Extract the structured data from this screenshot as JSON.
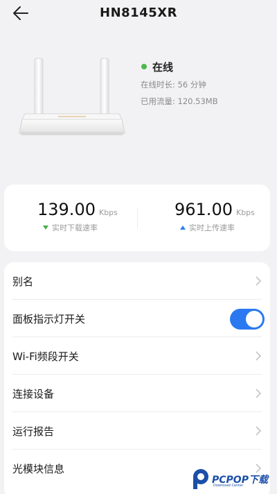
{
  "header": {
    "title": "HN8145XR"
  },
  "device": {
    "status": "在线",
    "online_duration": "在线时长: 56 分钟",
    "used_traffic": "已用流量: 120.53MB"
  },
  "speed": {
    "download": {
      "value": "139.00",
      "unit": "Kbps",
      "label": "实时下载速率"
    },
    "upload": {
      "value": "961.00",
      "unit": "Kbps",
      "label": "实时上传速率"
    }
  },
  "settings": {
    "alias": "别名",
    "panel_light": "面板指示灯开关",
    "panel_light_on": true,
    "wifi_band": "Wi-Fi频段开关",
    "connected_devices": "连接设备",
    "run_report": "运行报告",
    "optical_module": "光模块信息"
  },
  "watermark": {
    "text": "PCPOP下载",
    "sub": "Download Center"
  },
  "colors": {
    "online": "#4cb84c",
    "accent": "#2a79f0",
    "download_arrow": "#44b244",
    "upload_arrow": "#2b80f0"
  }
}
